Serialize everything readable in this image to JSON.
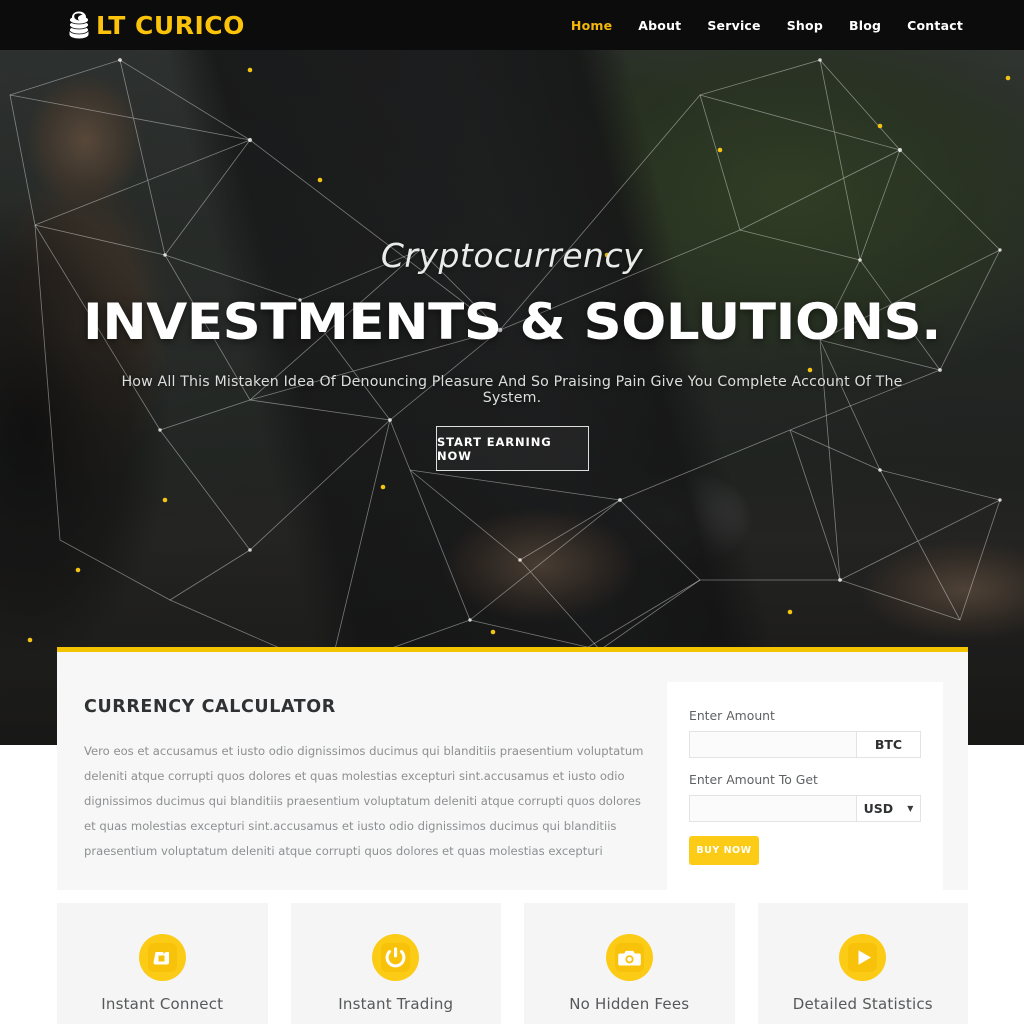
{
  "header": {
    "logo": {
      "icon": "coin-stack-icon",
      "text": "LT CURICO",
      "color": "#fcc30b"
    },
    "nav": [
      {
        "label": "Home",
        "active": true
      },
      {
        "label": "About",
        "active": false
      },
      {
        "label": "Service",
        "active": false
      },
      {
        "label": "Shop",
        "active": false
      },
      {
        "label": "Blog",
        "active": false
      },
      {
        "label": "Contact",
        "active": false
      }
    ],
    "background": "#0c0c0c"
  },
  "hero": {
    "subtitle": "Cryptocurrency",
    "title": "INVESTMENTS & SOLUTIONS.",
    "description": "How All This Mistaken Idea Of Denouncing Pleasure And So Praising Pain Give You Complete Account Of The System.",
    "cta_label": "START EARNING NOW"
  },
  "calculator": {
    "heading": "CURRENCY CALCULATOR",
    "body": "Vero eos et accusamus et iusto odio dignissimos ducimus qui blanditiis praesentium voluptatum deleniti atque corrupti quos dolores et quas molestias excepturi sint.accusamus et iusto odio dignissimos ducimus qui blanditiis praesentium voluptatum deleniti atque corrupti quos dolores et quas molestias excepturi sint.accusamus et iusto odio dignissimos ducimus qui blanditiis praesentium voluptatum deleniti atque corrupti quos dolores et quas molestias excepturi",
    "accent_color": "#f5c400",
    "fields": {
      "amount_label": "Enter Amount",
      "amount_value": "",
      "amount_placeholder": "",
      "amount_unit": "BTC",
      "target_label": "Enter Amount To Get",
      "target_value": "",
      "target_placeholder": "",
      "target_unit": "USD"
    },
    "buy_label": "BUY NOW",
    "buy_color": "#fbcb16"
  },
  "features": [
    {
      "label": "Instant Connect",
      "icon": "dashboard-square-icon"
    },
    {
      "label": "Instant Trading",
      "icon": "power-icon"
    },
    {
      "label": "No Hidden Fees",
      "icon": "camera-icon"
    },
    {
      "label": "Detailed Statistics",
      "icon": "play-icon"
    }
  ]
}
